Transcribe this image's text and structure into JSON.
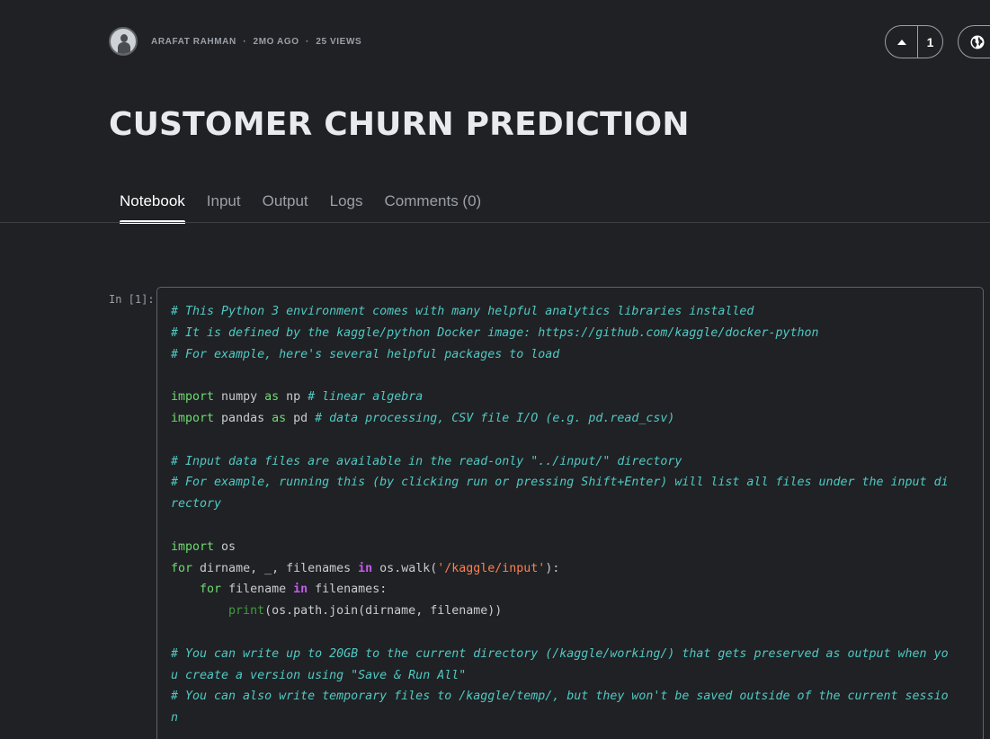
{
  "header": {
    "author": "ARAFAT RAHMAN",
    "age": "2MO AGO",
    "views": "25 VIEWS",
    "separator": "·",
    "vote_count": "1"
  },
  "title": "CUSTOMER CHURN PREDICTION",
  "tabs": [
    {
      "label": "Notebook",
      "active": true
    },
    {
      "label": "Input",
      "active": false
    },
    {
      "label": "Output",
      "active": false
    },
    {
      "label": "Logs",
      "active": false
    },
    {
      "label": "Comments (0)",
      "active": false
    }
  ],
  "cell": {
    "prompt": "In [1]:",
    "lines": [
      [
        {
          "t": "cm",
          "v": "# This Python 3 environment comes with many helpful analytics libraries installed"
        }
      ],
      [
        {
          "t": "cm",
          "v": "# It is defined by the kaggle/python Docker image: https://github.com/kaggle/docker-python"
        }
      ],
      [
        {
          "t": "cm",
          "v": "# For example, here's several helpful packages to load"
        }
      ],
      [],
      [
        {
          "t": "kw",
          "v": "import"
        },
        {
          "t": "id",
          "v": " numpy "
        },
        {
          "t": "kw",
          "v": "as"
        },
        {
          "t": "id",
          "v": " np "
        },
        {
          "t": "cm",
          "v": "# linear algebra"
        }
      ],
      [
        {
          "t": "kw",
          "v": "import"
        },
        {
          "t": "id",
          "v": " pandas "
        },
        {
          "t": "kw",
          "v": "as"
        },
        {
          "t": "id",
          "v": " pd "
        },
        {
          "t": "cm",
          "v": "# data processing, CSV file I/O (e.g. pd.read_csv)"
        }
      ],
      [],
      [
        {
          "t": "cm",
          "v": "# Input data files are available in the read-only \"../input/\" directory"
        }
      ],
      [
        {
          "t": "cm",
          "v": "# For example, running this (by clicking run or pressing Shift+Enter) will list all files under the input di"
        }
      ],
      [
        {
          "t": "cm",
          "v": "rectory"
        }
      ],
      [],
      [
        {
          "t": "kw",
          "v": "import"
        },
        {
          "t": "id",
          "v": " os"
        }
      ],
      [
        {
          "t": "kw",
          "v": "for"
        },
        {
          "t": "id",
          "v": " dirname, _, filenames "
        },
        {
          "t": "kw2",
          "v": "in"
        },
        {
          "t": "id",
          "v": " os.walk("
        },
        {
          "t": "str",
          "v": "'/kaggle/input'"
        },
        {
          "t": "id",
          "v": "):"
        }
      ],
      [
        {
          "t": "id",
          "v": "    "
        },
        {
          "t": "kw",
          "v": "for"
        },
        {
          "t": "id",
          "v": " filename "
        },
        {
          "t": "kw2",
          "v": "in"
        },
        {
          "t": "id",
          "v": " filenames:"
        }
      ],
      [
        {
          "t": "id",
          "v": "        "
        },
        {
          "t": "bi",
          "v": "print"
        },
        {
          "t": "id",
          "v": "(os.path.join(dirname, filename))"
        }
      ],
      [],
      [
        {
          "t": "cm",
          "v": "# You can write up to 20GB to the current directory (/kaggle/working/) that gets preserved as output when yo"
        }
      ],
      [
        {
          "t": "cm",
          "v": "u create a version using \"Save & Run All\""
        }
      ],
      [
        {
          "t": "cm",
          "v": "# You can also write temporary files to /kaggle/temp/, but they won't be saved outside of the current sessio"
        }
      ],
      [
        {
          "t": "cm",
          "v": "n"
        }
      ]
    ]
  },
  "icons": {
    "upvote": "upvote-arrow-icon",
    "globe": "globe-icon"
  }
}
